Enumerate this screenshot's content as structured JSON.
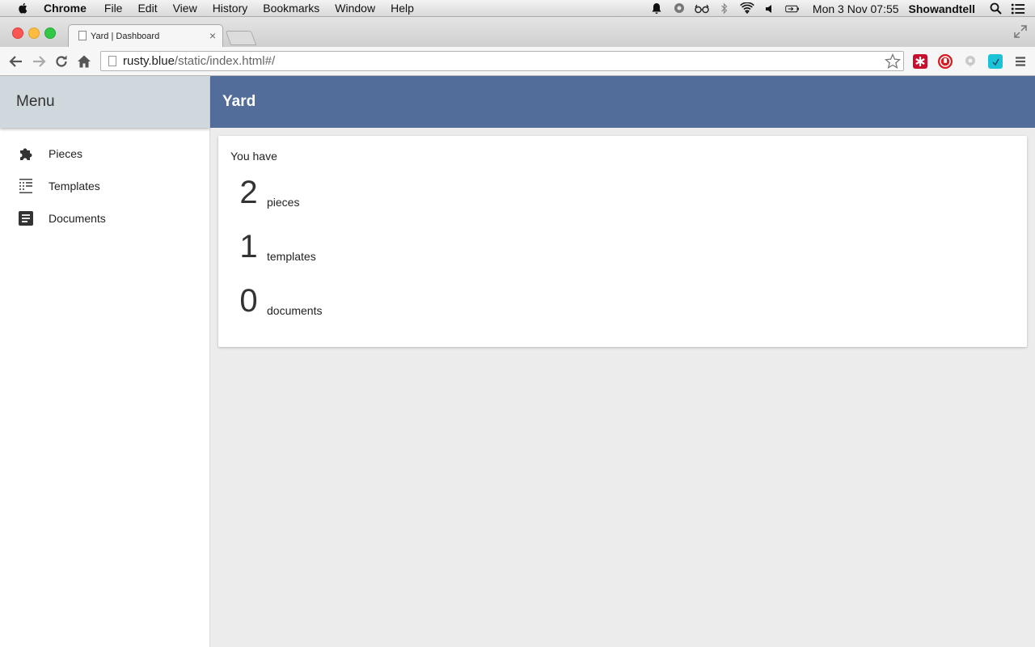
{
  "menubar": {
    "app_name": "Chrome",
    "menus": [
      "File",
      "Edit",
      "View",
      "History",
      "Bookmarks",
      "Window",
      "Help"
    ],
    "clock": "Mon 3 Nov  07:55",
    "user": "Showandtell"
  },
  "browser": {
    "tab_title": "Yard | Dashboard",
    "tab_close": "×",
    "url_host": "rusty.blue",
    "url_path": "/static/index.html#/"
  },
  "sidebar": {
    "title": "Menu",
    "items": [
      {
        "label": "Pieces",
        "icon": "puzzle-icon"
      },
      {
        "label": "Templates",
        "icon": "grid-list-icon"
      },
      {
        "label": "Documents",
        "icon": "document-icon"
      }
    ]
  },
  "appbar": {
    "title": "Yard"
  },
  "dashboard": {
    "intro": "You have",
    "stats": [
      {
        "count": "2",
        "label": "pieces"
      },
      {
        "count": "1",
        "label": "templates"
      },
      {
        "count": "0",
        "label": "documents"
      }
    ]
  },
  "colors": {
    "appbar": "#536d9b",
    "sidebar_header": "#cfd8dd",
    "content_bg": "#ececec"
  }
}
